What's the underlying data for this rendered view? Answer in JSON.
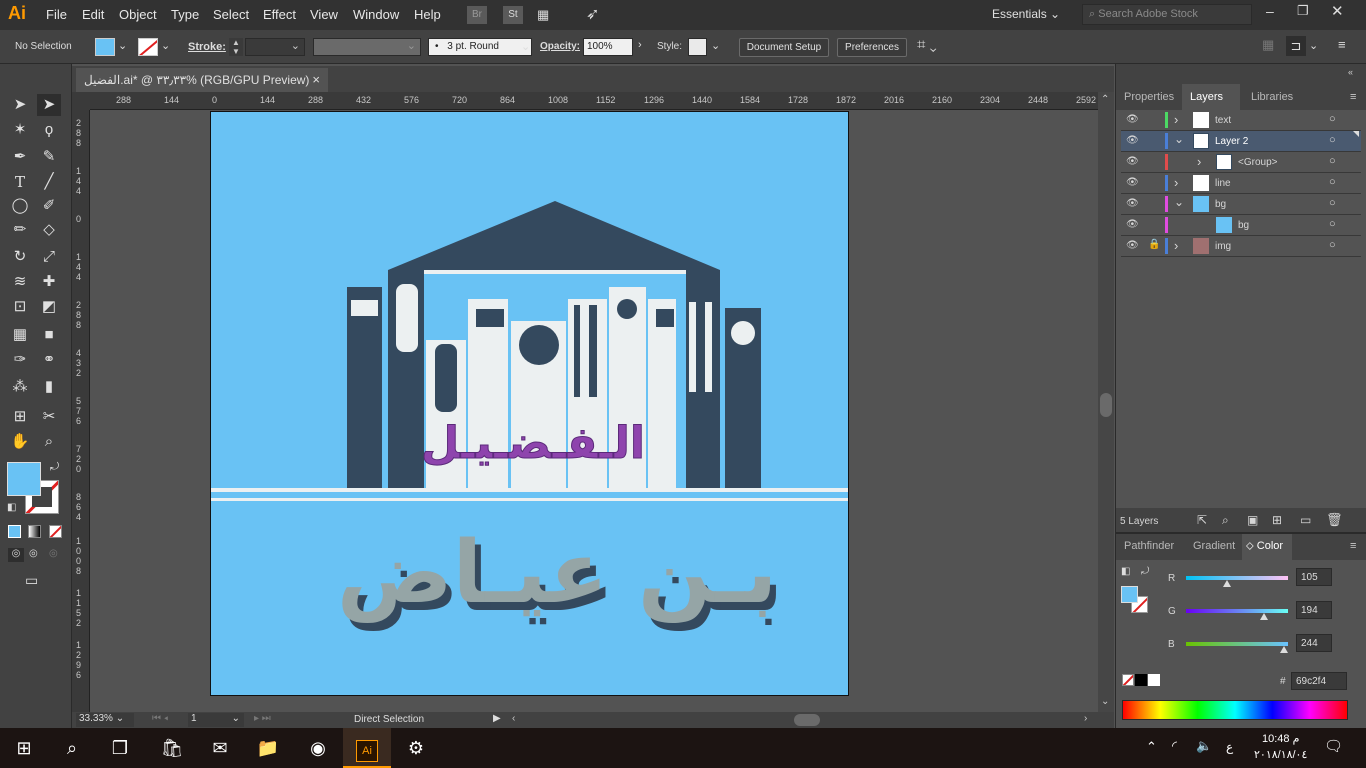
{
  "app_logo": "Ai",
  "menu": [
    "File",
    "Edit",
    "Object",
    "Type",
    "Select",
    "Effect",
    "View",
    "Window",
    "Help"
  ],
  "menu_right": {
    "br": "Br",
    "st": "St",
    "workspace": "Essentials",
    "search_placeholder": "Search Adobe Stock"
  },
  "control": {
    "selection": "No Selection",
    "stroke_label": "Stroke:",
    "brush": "3 pt. Round",
    "opacity_label": "Opacity:",
    "opacity_value": "100%",
    "style_label": "Style:",
    "document_setup": "Document Setup",
    "preferences": "Preferences"
  },
  "doc_tab": {
    "title": "الفضيل.ai* @ ٣٣٫٣٣% (RGB/GPU Preview)",
    "close": "×"
  },
  "ruler_h": [
    "288",
    "144",
    "0",
    "144",
    "288",
    "432",
    "576",
    "720",
    "864",
    "1008",
    "1152",
    "1296",
    "1440",
    "1584",
    "1728",
    "1872",
    "2016",
    "2160",
    "2304",
    "2448",
    "2592"
  ],
  "ruler_v": [
    "2 8 8",
    "1 4 4",
    "0",
    "1 4 4",
    "2 8 8",
    "4 3 2",
    "5 7 6",
    "7 2 0",
    "8 6 4",
    "1 0 0 8",
    "1 1 5 2",
    "1 2 9 6",
    "1 4 4 0",
    "1 5 8 4",
    "1 7 2 8",
    "1 8 7 2"
  ],
  "artwork": {
    "text_top": "الـفـضـيـل",
    "text_bottom": "بـن عيـاض",
    "bg_color": "#69c2f4",
    "dark_color": "#34495e",
    "light_color": "#ecf0f1",
    "purple": "#8e44ad",
    "gray": "#95a5a6"
  },
  "status": {
    "zoom": "33.33%",
    "page": "1",
    "tool": "Direct Selection"
  },
  "panels": {
    "top_tabs": [
      "Properties",
      "Layers",
      "Libraries"
    ],
    "active_top_tab": "Layers",
    "layers": [
      {
        "name": "text",
        "color": "#4cd964",
        "indent": 0,
        "expand": "›"
      },
      {
        "name": "Layer 2",
        "color": "#4a7fd8",
        "indent": 0,
        "expand": "⌄"
      },
      {
        "name": "<Group>",
        "color": "#e04c4c",
        "indent": 1,
        "expand": "›"
      },
      {
        "name": "line",
        "color": "#4a7fd8",
        "indent": 0,
        "expand": "›"
      },
      {
        "name": "bg",
        "color": "#e04ce0",
        "indent": 0,
        "expand": "⌄"
      },
      {
        "name": "bg",
        "color": "#e04ce0",
        "indent": 1,
        "expand": ""
      },
      {
        "name": "img",
        "color": "#4a7fd8",
        "indent": 0,
        "expand": "›"
      }
    ],
    "layer_count": "5 Layers",
    "bottom_tabs": [
      "Pathfinder",
      "Gradient",
      "Color"
    ],
    "active_bottom_tab": "Color",
    "color": {
      "r_label": "R",
      "g_label": "G",
      "b_label": "B",
      "r": "105",
      "g": "194",
      "b": "244",
      "hash": "#",
      "hex": "69c2f4",
      "r_level": 0.41,
      "g_level": 0.76,
      "b_level": 0.96
    }
  },
  "taskbar": {
    "time": "10:48 م",
    "date": "٢٠١٨/١٨/٠٤",
    "lang": "ع"
  }
}
